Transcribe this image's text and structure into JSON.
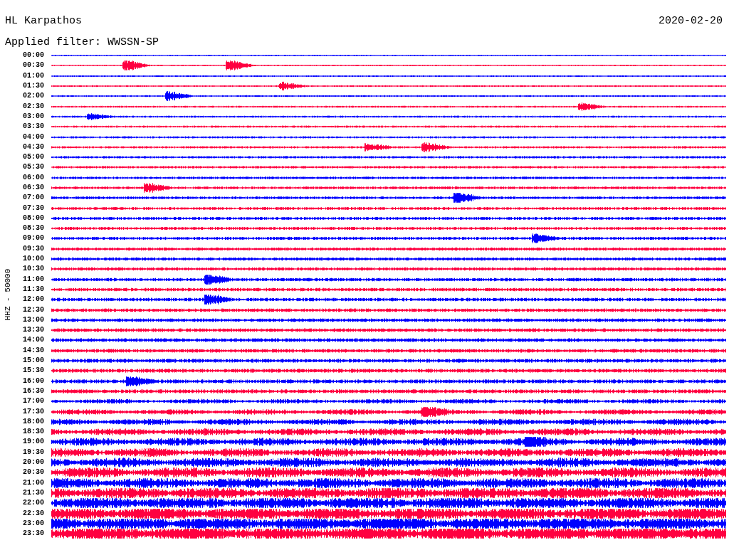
{
  "header": {
    "station": "HL Karpathos",
    "date": "2020-02-20",
    "filter": "Applied filter: WWSSN-SP"
  },
  "axis_label": "HHZ - 50000",
  "traces": [
    {
      "time": "00:00",
      "color": "#0000ff"
    },
    {
      "time": "00:30",
      "color": "#ff0040"
    },
    {
      "time": "01:00",
      "color": "#0000ff"
    },
    {
      "time": "01:30",
      "color": "#ff0040"
    },
    {
      "time": "02:00",
      "color": "#0000ff"
    },
    {
      "time": "02:30",
      "color": "#ff0040"
    },
    {
      "time": "03:00",
      "color": "#0000ff"
    },
    {
      "time": "03:30",
      "color": "#ff0040"
    },
    {
      "time": "04:00",
      "color": "#0000ff"
    },
    {
      "time": "04:30",
      "color": "#ff0040"
    },
    {
      "time": "05:00",
      "color": "#0000ff"
    },
    {
      "time": "05:30",
      "color": "#ff0040"
    },
    {
      "time": "06:00",
      "color": "#0000ff"
    },
    {
      "time": "06:30",
      "color": "#ff0040"
    },
    {
      "time": "07:00",
      "color": "#0000ff"
    },
    {
      "time": "07:30",
      "color": "#ff0040"
    },
    {
      "time": "08:00",
      "color": "#0000ff"
    },
    {
      "time": "08:30",
      "color": "#ff0040"
    },
    {
      "time": "09:00",
      "color": "#0000ff"
    },
    {
      "time": "09:30",
      "color": "#ff0040"
    },
    {
      "time": "10:00",
      "color": "#0000ff"
    },
    {
      "time": "10:30",
      "color": "#ff0040"
    },
    {
      "time": "11:00",
      "color": "#0000ff"
    },
    {
      "time": "11:30",
      "color": "#ff0040"
    },
    {
      "time": "12:00",
      "color": "#0000ff"
    },
    {
      "time": "12:30",
      "color": "#ff0040"
    },
    {
      "time": "13:00",
      "color": "#0000ff"
    },
    {
      "time": "13:30",
      "color": "#ff0040"
    },
    {
      "time": "14:00",
      "color": "#0000ff"
    },
    {
      "time": "14:30",
      "color": "#ff0040"
    },
    {
      "time": "15:00",
      "color": "#0000ff"
    },
    {
      "time": "15:30",
      "color": "#ff0040"
    },
    {
      "time": "16:00",
      "color": "#0000ff"
    },
    {
      "time": "16:30",
      "color": "#ff0040"
    },
    {
      "time": "17:00",
      "color": "#0000ff"
    },
    {
      "time": "17:30",
      "color": "#ff0040"
    },
    {
      "time": "18:00",
      "color": "#0000ff"
    },
    {
      "time": "18:30",
      "color": "#ff0040"
    },
    {
      "time": "19:00",
      "color": "#0000ff"
    },
    {
      "time": "19:30",
      "color": "#ff0040"
    },
    {
      "time": "20:00",
      "color": "#0000ff"
    },
    {
      "time": "20:30",
      "color": "#ff0040"
    },
    {
      "time": "21:00",
      "color": "#0000ff"
    },
    {
      "time": "21:30",
      "color": "#ff0040"
    },
    {
      "time": "22:00",
      "color": "#0000ff"
    },
    {
      "time": "22:30",
      "color": "#ff0040"
    },
    {
      "time": "23:00",
      "color": "#0000ff"
    },
    {
      "time": "23:30",
      "color": "#ff0040"
    }
  ]
}
